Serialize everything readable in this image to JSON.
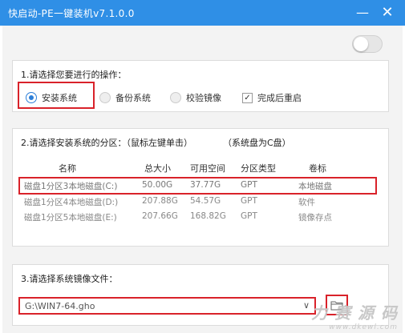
{
  "window": {
    "title": "快启动-PE一键装机v7.1.0.0",
    "minimize_label": "—",
    "close_label": "✕"
  },
  "toggle": {
    "state": "off"
  },
  "section1": {
    "title": "1.请选择您要进行的操作：",
    "options": [
      {
        "label": "安装系统",
        "selected": true
      },
      {
        "label": "备份系统",
        "selected": false
      },
      {
        "label": "校验镜像",
        "selected": false
      }
    ],
    "restart_checkbox": {
      "label": "完成后重启",
      "checked": true,
      "mark": "✓"
    }
  },
  "section2": {
    "title": "2.请选择安装系统的分区：（鼠标左键单击）",
    "hint": "（系统盘为C盘）",
    "columns": [
      "名称",
      "总大小",
      "可用空间",
      "分区类型",
      "卷标"
    ],
    "rows": [
      [
        "磁盘1分区3本地磁盘(C:)",
        "50.00G",
        "37.77G",
        "GPT",
        "本地磁盘"
      ],
      [
        "磁盘1分区4本地磁盘(D:)",
        "207.88G",
        "54.57G",
        "GPT",
        "软件"
      ],
      [
        "磁盘1分区5本地磁盘(E:)",
        "207.66G",
        "168.82G",
        "GPT",
        "镜像存点"
      ]
    ]
  },
  "section3": {
    "title": "3.请选择系统镜像文件：",
    "image_file": "G:\\WIN7-64.gho",
    "dropdown_arrow": "∨"
  },
  "watermark": {
    "main": "力 赛 源 码",
    "sub": "www.dkewl.com"
  },
  "colors": {
    "titlebar": "#2f8fe6",
    "highlight": "#d9222a",
    "radio_selected": "#2d7fd8"
  }
}
